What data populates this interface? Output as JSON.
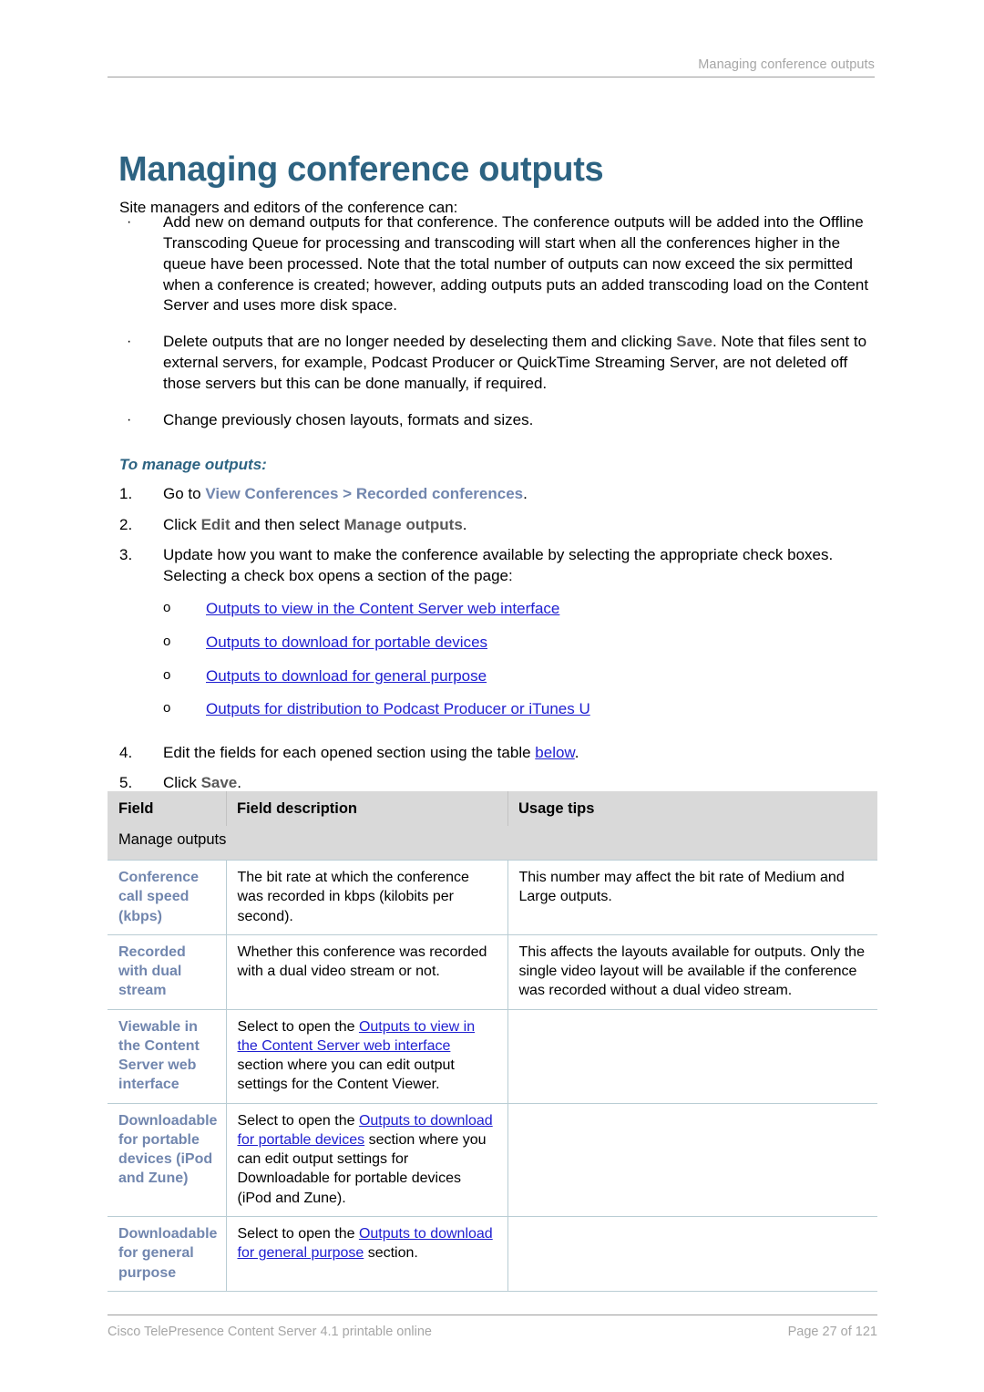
{
  "running_header": "Managing conference outputs",
  "title": "Managing conference outputs",
  "intro": "Site managers and editors of the conference can:",
  "bullets": [
    {
      "marker": "·",
      "text": "Add new on demand outputs for that conference. The conference outputs will be added into the Offline Transcoding Queue for processing and transcoding will start when all the conferences higher in the queue have been processed. Note that the total number of outputs can now exceed the six permitted when a conference is created; however, adding outputs puts an added transcoding load on the Content Server and uses more disk space."
    },
    {
      "marker": "·",
      "text_pre": "Delete outputs that are no longer needed by deselecting them and clicking ",
      "ui_label": "Save",
      "text_post": ". Note that files sent to external servers, for example, Podcast Producer or QuickTime Streaming Server, are not deleted off those servers but this can be done manually, if required."
    },
    {
      "marker": "·",
      "text": "Change previously chosen layouts, formats and sizes."
    }
  ],
  "sub_heading": "To manage outputs:",
  "steps": {
    "step1": {
      "num": "1.",
      "pre": "Go to ",
      "nav": "View Conferences > Recorded conferences",
      "post": "."
    },
    "step2": {
      "num": "2.",
      "pre": "Click ",
      "ui1": "Edit",
      "mid": " and then select ",
      "ui2": "Manage outputs",
      "post": "."
    },
    "step3": {
      "num": "3.",
      "text": "Update how you want to make the conference available by selecting the appropriate check boxes. Selecting a check box opens a section of the page:"
    },
    "sub_links": [
      {
        "marker": "o",
        "label": "Outputs to view in the Content Server web interface"
      },
      {
        "marker": "o",
        "label": "Outputs to download for portable devices"
      },
      {
        "marker": "o",
        "label": "Outputs to download for general purpose"
      },
      {
        "marker": "o",
        "label": "Outputs for distribution to Podcast Producer or iTunes U"
      }
    ],
    "step4": {
      "num": "4.",
      "pre": "Edit the fields for each opened section using the table ",
      "link": "below",
      "post": "."
    },
    "step5": {
      "num": "5.",
      "pre": "Click ",
      "ui1": "Save",
      "post": "."
    }
  },
  "table": {
    "headers": [
      "Field",
      "Field description",
      "Usage tips"
    ],
    "section_label": "Manage outputs",
    "rows": [
      {
        "field": "Conference call speed (kbps)",
        "desc": "The bit rate at which the conference was recorded in kbps (kilobits per second).",
        "tips": "This number may affect the bit rate of Medium and Large outputs."
      },
      {
        "field": "Recorded with dual stream",
        "desc": "Whether this conference was recorded with a dual video stream or not.",
        "tips": "This affects the layouts available for outputs. Only the single video layout will be available if the conference was recorded without a dual video stream."
      },
      {
        "field": "Viewable in the Content Server web interface",
        "desc_pre": "Select to open the ",
        "desc_link": "Outputs to view in the Content Server web interface",
        "desc_post": " section where you can edit output settings for the Content Viewer.",
        "tips": ""
      },
      {
        "field": "Downloadable for portable devices (iPod and Zune)",
        "desc_pre": "Select to open the ",
        "desc_link": "Outputs to download for portable devices",
        "desc_post": " section where you can edit output settings for Downloadable for portable devices (iPod and Zune).",
        "tips": ""
      },
      {
        "field": "Downloadable for general purpose",
        "desc_pre": "Select to open the ",
        "desc_link": "Outputs to download for general purpose",
        "desc_post": " section.",
        "tips": ""
      }
    ]
  },
  "footer": {
    "left": "Cisco TelePresence Content Server 4.1 printable online",
    "right": "Page 27 of 121"
  },
  "colors": {
    "title": "#2d6382",
    "nav_label": "#7186ae",
    "ui_label": "#595959",
    "link": "#2020d0",
    "header_bg": "#d9d9d9",
    "table_border": "#b9cdd4",
    "muted": "#a6a6a6"
  }
}
